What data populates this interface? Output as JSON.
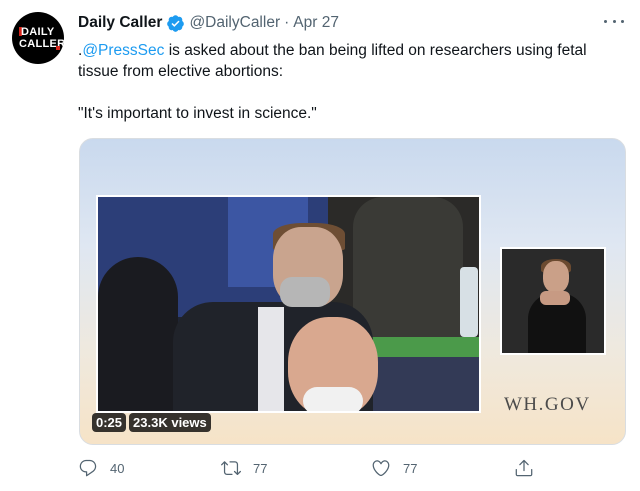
{
  "tweet": {
    "author": {
      "display_name": "Daily Caller",
      "handle": "@DailyCaller",
      "separator": "·",
      "date": "Apr 27",
      "avatar_text_line1": "DAILY",
      "avatar_text_line2": "CALLER",
      "verified": true
    },
    "text": {
      "prefix": ".",
      "mention": "@PressSec",
      "rest": " is asked about the ban being lifted on researchers using fetal tissue from elective abortions:",
      "quote": "\"It's important to invest in science.\""
    },
    "media": {
      "watermark": "WH.GOV",
      "duration": "0:25",
      "views": "23.3K views"
    },
    "actions": {
      "reply": {
        "icon": "reply-icon",
        "count": "40"
      },
      "retweet": {
        "icon": "retweet-icon",
        "count": "77"
      },
      "like": {
        "icon": "heart-icon",
        "count": "77"
      },
      "share": {
        "icon": "share-icon"
      }
    }
  },
  "colors": {
    "accent": "#1d9bf0",
    "secondary_text": "#536471",
    "primary_text": "#0f1419"
  }
}
